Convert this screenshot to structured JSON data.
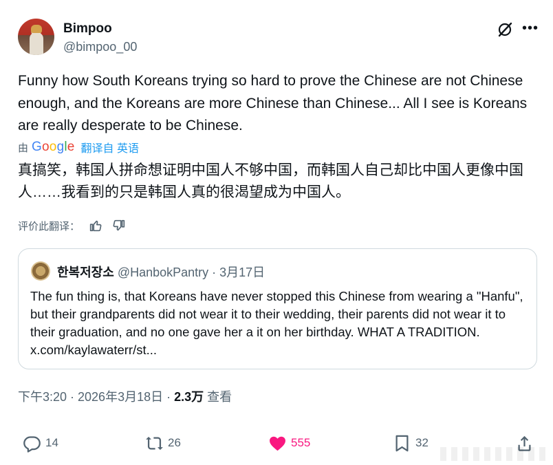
{
  "author": {
    "display_name": "Bimpoo",
    "handle": "@bimpoo_00"
  },
  "tweet": {
    "text": "Funny how South Koreans trying so hard to prove the Chinese are not Chinese enough, and the Koreans are more Chinese than Chinese... All I see is Koreans are really desperate to be Chinese.",
    "translation": {
      "by_label": "由",
      "provider_google": [
        "G",
        "o",
        "o",
        "g",
        "l",
        "e"
      ],
      "link_label": "翻译自 英语",
      "text": "真搞笑，韩国人拼命想证明中国人不够中国，而韩国人自己却比中国人更像中国人……我看到的只是韩国人真的很渴望成为中国人。",
      "rate_label": "评价此翻译："
    }
  },
  "quote": {
    "name": "한복저장소",
    "handle_date": " @HanbokPantry · 3月17日",
    "text": "The fun thing is, that Koreans have never stopped this Chinese from wearing a \"Hanfu\", but their grandparents did not wear it to their wedding, their parents did not wear it to their graduation, and no one gave her a it on her birthday. WHAT A TRADITION. x.com/kaylawaterr/st..."
  },
  "meta": {
    "time_date": "下午3:20 · 2026年3月18日 · ",
    "views_count": "2.3万",
    "views_label": " 查看"
  },
  "actions": {
    "replies": "14",
    "reposts": "26",
    "likes": "555",
    "bookmarks": "32"
  },
  "icons": {
    "grok": "grok-icon",
    "more": "more-icon",
    "reply": "reply-icon",
    "repost": "repost-icon",
    "like": "heart-icon",
    "bookmark": "bookmark-icon",
    "share": "share-icon",
    "thumb_up": "thumb-up-icon",
    "thumb_down": "thumb-down-icon"
  },
  "colors": {
    "accent": "#1d9bf0",
    "like": "#f91880",
    "secondary_text": "#536471"
  }
}
